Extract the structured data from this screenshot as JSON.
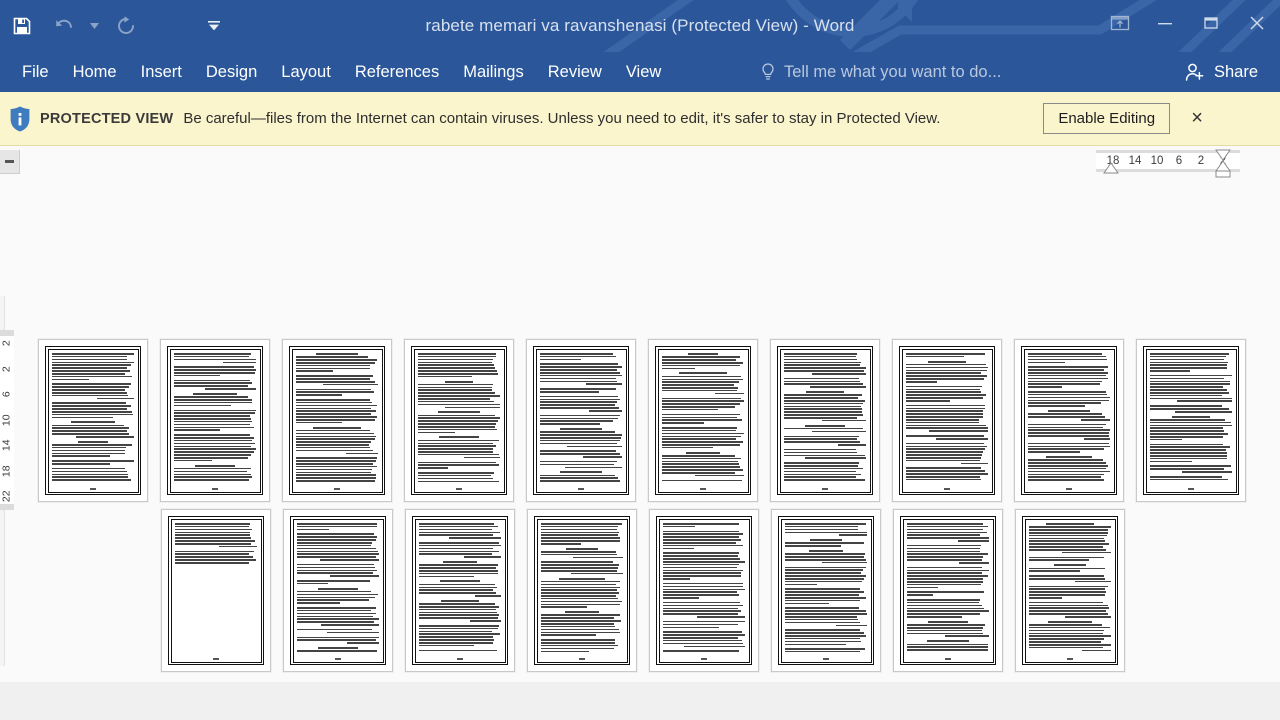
{
  "window": {
    "title": "rabete memari va ravanshenasi (Protected View) - Word",
    "accent_color": "#2b579a",
    "quick_access": [
      {
        "name": "save-button",
        "icon": "save-icon",
        "enabled": true
      },
      {
        "name": "undo-button",
        "icon": "undo-icon",
        "enabled": false
      },
      {
        "name": "undo-dropdown",
        "icon": "chevron-down-icon",
        "enabled": false
      },
      {
        "name": "redo-button",
        "icon": "redo-icon",
        "enabled": false
      },
      {
        "name": "customize-quick-access-toolbar",
        "icon": "chevron-down-icon",
        "enabled": true
      }
    ],
    "controls": {
      "ribbon_display_options": "ribbon-display-options-icon",
      "minimize": "minimize-icon",
      "restore": "restore-icon",
      "close": "close-icon"
    }
  },
  "ribbon": {
    "tabs": [
      {
        "label": "File"
      },
      {
        "label": "Home"
      },
      {
        "label": "Insert"
      },
      {
        "label": "Design"
      },
      {
        "label": "Layout"
      },
      {
        "label": "References"
      },
      {
        "label": "Mailings"
      },
      {
        "label": "Review"
      },
      {
        "label": "View"
      }
    ],
    "tell_me_placeholder": "Tell me what you want to do...",
    "share_label": "Share"
  },
  "protected_view": {
    "label": "PROTECTED VIEW",
    "message": "Be careful—files from the Internet can contain viruses. Unless you need to edit, it's safer to stay in Protected View.",
    "enable_button": "Enable Editing",
    "close": "×",
    "background_color": "#fbf5ce"
  },
  "rulers": {
    "horizontal": [
      "18",
      "14",
      "10",
      "6",
      "2",
      "2"
    ],
    "vertical": [
      "2",
      "2",
      "6",
      "10",
      "14",
      "18",
      "22"
    ],
    "tab_selector": "left-tab-stop"
  },
  "document": {
    "view_mode": "multiple-pages",
    "rows": [
      {
        "page_count": 10
      },
      {
        "page_count": 8
      }
    ],
    "total_pages": 18,
    "page_background": "#ffffff"
  }
}
